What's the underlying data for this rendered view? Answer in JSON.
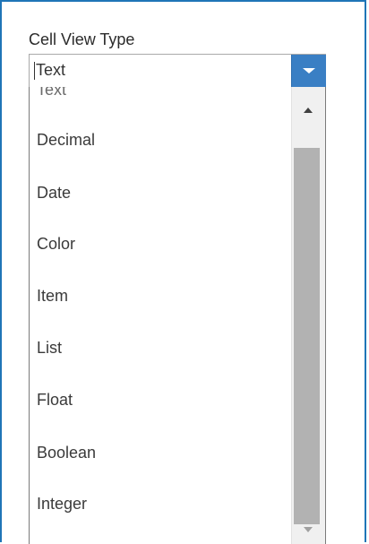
{
  "field": {
    "label": "Cell View Type",
    "selected_value": "Text",
    "dropdown_icon": "chevron-down-icon"
  },
  "options": [
    "Text",
    "Decimal",
    "Date",
    "Color",
    "Item",
    "List",
    "Float",
    "Boolean",
    "Integer"
  ],
  "scrollbar": {
    "up_icon": "scroll-up-icon",
    "down_icon": "scroll-down-icon"
  },
  "colors": {
    "frame_border": "#1f75b7",
    "button_accent": "#3a7fc4",
    "scroll_thumb": "#b2b2b2"
  }
}
